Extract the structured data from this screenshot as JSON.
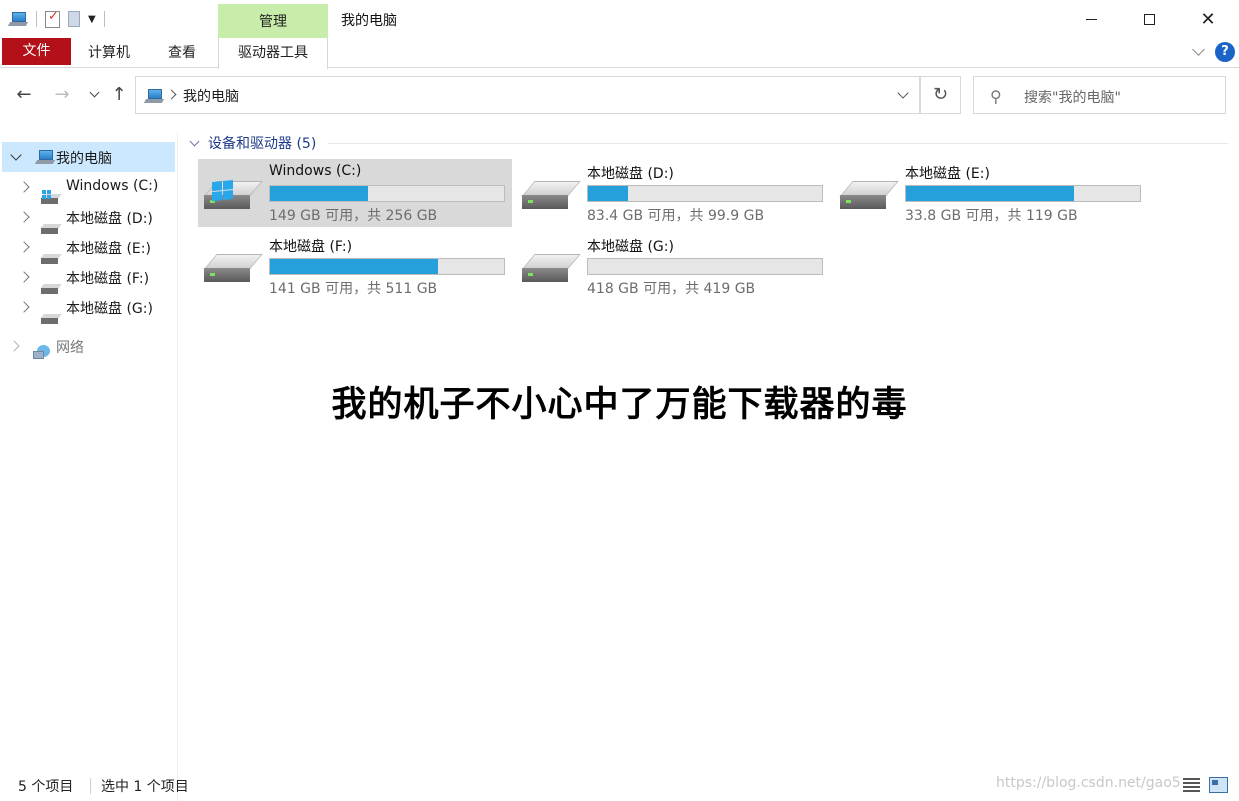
{
  "window": {
    "title": "我的电脑",
    "contextual_tab": "管理"
  },
  "ribbon": {
    "tabs": [
      {
        "label": "文件"
      },
      {
        "label": "计算机"
      },
      {
        "label": "查看"
      },
      {
        "label": "驱动器工具"
      }
    ],
    "help_label": "?"
  },
  "address": {
    "crumb": "我的电脑",
    "search_placeholder": "搜索\"我的电脑\""
  },
  "sidebar": {
    "root": "我的电脑",
    "items": [
      {
        "label": "Windows (C:)"
      },
      {
        "label": "本地磁盘 (D:)"
      },
      {
        "label": "本地磁盘 (E:)"
      },
      {
        "label": "本地磁盘 (F:)"
      },
      {
        "label": "本地磁盘 (G:)"
      }
    ],
    "network": "网络"
  },
  "content": {
    "group_label": "设备和驱动器 (5)",
    "drives": [
      {
        "name": "Windows (C:)",
        "free": "149 GB 可用，共 256 GB",
        "used_fraction": 0.42
      },
      {
        "name": "本地磁盘 (D:)",
        "free": "83.4 GB 可用，共 99.9 GB",
        "used_fraction": 0.17
      },
      {
        "name": "本地磁盘 (E:)",
        "free": "33.8 GB 可用，共 119 GB",
        "used_fraction": 0.72
      },
      {
        "name": "本地磁盘 (F:)",
        "free": "141 GB 可用，共 511 GB",
        "used_fraction": 0.72
      },
      {
        "name": "本地磁盘 (G:)",
        "free": "418 GB 可用，共 419 GB",
        "used_fraction": 0.0
      }
    ]
  },
  "caption": "我的机子不小心中了万能下载器的毒",
  "status": {
    "count": "5 个项目",
    "selected": "选中 1 个项目",
    "watermark": "https://blog.csdn.net/gao5"
  },
  "colors": {
    "file_tab": "#b3101a",
    "manage_tab": "#c8ecaa",
    "bar_fill": "#26a0da",
    "selection": "#cce8ff"
  }
}
